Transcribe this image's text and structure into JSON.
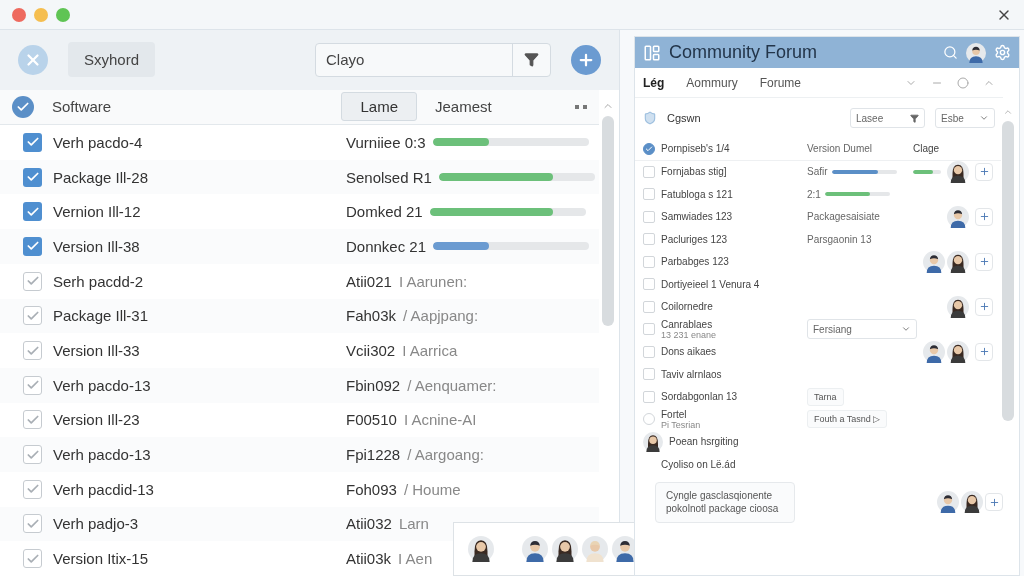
{
  "toolbar": {
    "button": "Sxyhord",
    "dropdown": {
      "value": "Clayo"
    }
  },
  "list_header": {
    "checked": true,
    "column_1": "Software",
    "button": "Lame",
    "column_3": "Jeamest"
  },
  "rows": [
    {
      "kind": "bar",
      "checked": true,
      "disabled": false,
      "name": "Verh pacdo-4",
      "value": "Vurniiee 0:3",
      "level": 0.36,
      "color": "#6cc07a"
    },
    {
      "kind": "bar",
      "checked": true,
      "disabled": false,
      "name": "Package Ill-28",
      "value": "Senolsed R1",
      "level": 0.73,
      "color": "#6cc07a"
    },
    {
      "kind": "bar",
      "checked": true,
      "disabled": false,
      "name": "Vernion Ill-12",
      "value": "Domked 21",
      "level": 0.79,
      "color": "#6cc07a"
    },
    {
      "kind": "bar",
      "checked": true,
      "disabled": false,
      "name": "Version Ill-38",
      "value": "Donnkec 21",
      "level": 0.36,
      "color": "#6b9bd1"
    },
    {
      "kind": "note",
      "checked": true,
      "disabled": true,
      "name": "Serh pacdd-2",
      "value": "Atii021",
      "note": "I Aarunen:"
    },
    {
      "kind": "note",
      "checked": true,
      "disabled": true,
      "name": "Package Ill-31",
      "value": "Fah03k",
      "note": "/ Aapjpang:"
    },
    {
      "kind": "note",
      "checked": true,
      "disabled": true,
      "name": "Version Ill-33",
      "value": "Vcii302",
      "note": "I Aarrica"
    },
    {
      "kind": "note",
      "checked": true,
      "disabled": true,
      "name": "Verh pacdo-13",
      "value": "Fbin092",
      "note": "/ Aenquamer:"
    },
    {
      "kind": "note",
      "checked": true,
      "disabled": true,
      "name": "Version Ill-23",
      "value": "F00510",
      "note": "I Acnine-AI"
    },
    {
      "kind": "note",
      "checked": true,
      "disabled": true,
      "name": "Verh pacdo-13",
      "value": "Fpi1228",
      "note": "/ Aargoang:"
    },
    {
      "kind": "note",
      "checked": true,
      "disabled": true,
      "name": "Verh pacdid-13",
      "value": "Foh093",
      "note": "/ Houme"
    },
    {
      "kind": "note",
      "checked": true,
      "disabled": true,
      "name": "Verh padjo-3",
      "value": "Atii032",
      "note": "Larn"
    },
    {
      "kind": "note",
      "checked": true,
      "disabled": true,
      "name": "Version Itix-15",
      "value": "Atii03k",
      "note": "I Aen"
    }
  ],
  "forum": {
    "title": "Community Forum",
    "tabs": [
      {
        "label": "Lég",
        "selected": true
      },
      {
        "label": "Aommury",
        "selected": false
      },
      {
        "label": "Forume",
        "selected": false
      }
    ],
    "filter": {
      "label": "Cgswn",
      "dropdown_1": "Lasee",
      "dropdown_2": "Esbe"
    },
    "header": {
      "checked": true,
      "column_1": "Pornpiseb's 1/4",
      "column_2": "Version Dumel",
      "column_3": "Clage"
    },
    "rows": [
      {
        "kind": "box",
        "checked": false,
        "name": "Fornjabas stig]",
        "column_2": "Safir",
        "bar": {
          "level": 0.72,
          "color": "#5b8fc7"
        },
        "mini_bar": {
          "level": 0.7
        },
        "avatars": [
          {
            "kind": "woman"
          }
        ],
        "action": true
      },
      {
        "kind": "box",
        "checked": false,
        "name": "Fatubloga s 121",
        "column_2": "2:1",
        "bar": {
          "level": 0.7,
          "color": "#6cc07a"
        }
      },
      {
        "kind": "box",
        "checked": false,
        "name": "Samwiades 123",
        "column_2": "Packagesaisiate",
        "avatars": [
          {
            "kind": "man"
          }
        ],
        "action": true
      },
      {
        "kind": "box",
        "checked": false,
        "name": "Pacluriges 123",
        "column_2": "Parsgaonin 13"
      },
      {
        "kind": "box",
        "checked": false,
        "name": "Parbabges 123",
        "avatars": [
          {
            "kind": "man"
          },
          {
            "kind": "woman"
          }
        ],
        "action": true
      },
      {
        "kind": "box",
        "checked": false,
        "name": "Dortiyeieel 1 Venura 4"
      },
      {
        "kind": "box",
        "checked": false,
        "name": "Coilornedre",
        "avatars": [
          {
            "kind": "woman"
          }
        ],
        "action": true
      },
      {
        "kind": "box",
        "checked": false,
        "name": "Canrablaes",
        "sub": "13 231 enane",
        "dropdown": "Fersiang"
      },
      {
        "kind": "box",
        "checked": false,
        "name": "Dons aikaes",
        "avatars": [
          {
            "kind": "man"
          },
          {
            "kind": "woman"
          }
        ],
        "action": true
      },
      {
        "kind": "box",
        "checked": false,
        "name": "Taviv alrnlaos"
      },
      {
        "kind": "box",
        "checked": false,
        "name": "Sordabgonlan 13",
        "tag": "Tarna"
      },
      {
        "kind": "radio",
        "checked": false,
        "name": "Fortel",
        "sub": "Pi Tesrian",
        "tag": "Fouth a Tasnd ▷"
      },
      {
        "kind": "avatar",
        "avatars": [
          {
            "kind": "woman"
          }
        ],
        "name": "Poean hsrgiting"
      },
      {
        "kind": "plain",
        "name": "Cyoliso on Lë.ád"
      }
    ],
    "card": {
      "text": "Cyngle gasclasqionente pokolnotl package cioosa",
      "avatars": [
        {
          "kind": "man"
        },
        {
          "kind": "woman"
        }
      ],
      "action": true
    }
  },
  "popup": {
    "avatars": [
      {
        "kind": "woman"
      },
      {
        "kind": "man"
      },
      {
        "kind": "woman"
      },
      {
        "kind": "baby"
      },
      {
        "kind": "man"
      }
    ]
  }
}
